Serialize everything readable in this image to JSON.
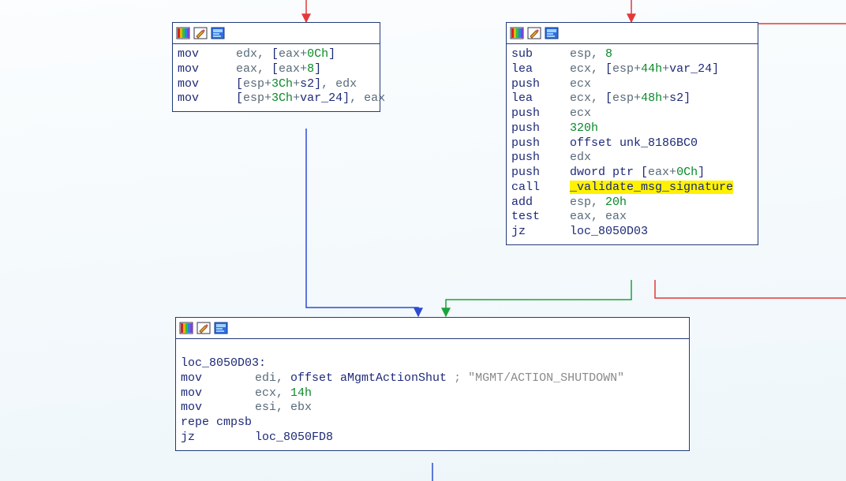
{
  "icons": {
    "rainbow": "rainbow-icon",
    "pencil": "pencil-icon",
    "script": "script-icon"
  },
  "colors": {
    "edge_red": "#e63838",
    "edge_blue": "#2e4bd3",
    "edge_green": "#1aa33a",
    "box_border": "#253a7a",
    "mnemonic": "#1e2a78",
    "register": "#596b7a",
    "number": "#0a8a2a",
    "highlight": "#fff200",
    "comment": "#8a8a8a"
  },
  "nodes": {
    "a": {
      "lines": [
        {
          "mn": "mov",
          "parts": [
            [
              "reg",
              "edx"
            ],
            [
              "punct",
              ", "
            ],
            [
              "brk",
              "["
            ],
            [
              "reg",
              "eax"
            ],
            [
              "punct",
              "+"
            ],
            [
              "num",
              "0Ch"
            ],
            [
              "brk",
              "]"
            ]
          ]
        },
        {
          "mn": "mov",
          "parts": [
            [
              "reg",
              "eax"
            ],
            [
              "punct",
              ", "
            ],
            [
              "brk",
              "["
            ],
            [
              "reg",
              "eax"
            ],
            [
              "punct",
              "+"
            ],
            [
              "num",
              "8"
            ],
            [
              "brk",
              "]"
            ]
          ]
        },
        {
          "mn": "mov",
          "parts": [
            [
              "brk",
              "["
            ],
            [
              "reg",
              "esp"
            ],
            [
              "punct",
              "+"
            ],
            [
              "num",
              "3Ch"
            ],
            [
              "punct",
              "+"
            ],
            [
              "name",
              "s2"
            ],
            [
              "brk",
              "]"
            ],
            [
              "punct",
              ", "
            ],
            [
              "reg",
              "edx"
            ]
          ]
        },
        {
          "mn": "mov",
          "parts": [
            [
              "brk",
              "["
            ],
            [
              "reg",
              "esp"
            ],
            [
              "punct",
              "+"
            ],
            [
              "num",
              "3Ch"
            ],
            [
              "punct",
              "+"
            ],
            [
              "name",
              "var_24"
            ],
            [
              "brk",
              "]"
            ],
            [
              "punct",
              ", "
            ],
            [
              "reg",
              "eax"
            ]
          ]
        }
      ]
    },
    "b": {
      "lines": [
        {
          "mn": "sub",
          "parts": [
            [
              "reg",
              "esp"
            ],
            [
              "punct",
              ", "
            ],
            [
              "num",
              "8"
            ]
          ]
        },
        {
          "mn": "lea",
          "parts": [
            [
              "reg",
              "ecx"
            ],
            [
              "punct",
              ", "
            ],
            [
              "brk",
              "["
            ],
            [
              "reg",
              "esp"
            ],
            [
              "punct",
              "+"
            ],
            [
              "num",
              "44h"
            ],
            [
              "punct",
              "+"
            ],
            [
              "name",
              "var_24"
            ],
            [
              "brk",
              "]"
            ]
          ]
        },
        {
          "mn": "push",
          "parts": [
            [
              "reg",
              "ecx"
            ]
          ]
        },
        {
          "mn": "lea",
          "parts": [
            [
              "reg",
              "ecx"
            ],
            [
              "punct",
              ", "
            ],
            [
              "brk",
              "["
            ],
            [
              "reg",
              "esp"
            ],
            [
              "punct",
              "+"
            ],
            [
              "num",
              "48h"
            ],
            [
              "punct",
              "+"
            ],
            [
              "name",
              "s2"
            ],
            [
              "brk",
              "]"
            ]
          ]
        },
        {
          "mn": "push",
          "parts": [
            [
              "reg",
              "ecx"
            ]
          ]
        },
        {
          "mn": "push",
          "parts": [
            [
              "num",
              "320h"
            ]
          ]
        },
        {
          "mn": "push",
          "parts": [
            [
              "name",
              "offset unk_8186BC0"
            ]
          ]
        },
        {
          "mn": "push",
          "parts": [
            [
              "reg",
              "edx"
            ]
          ]
        },
        {
          "mn": "push",
          "parts": [
            [
              "name",
              "dword ptr "
            ],
            [
              "brk",
              "["
            ],
            [
              "reg",
              "eax"
            ],
            [
              "punct",
              "+"
            ],
            [
              "num",
              "0Ch"
            ],
            [
              "brk",
              "]"
            ]
          ]
        },
        {
          "mn": "call",
          "parts": [
            [
              "hl",
              "_validate_msg_signature"
            ]
          ]
        },
        {
          "mn": "add",
          "parts": [
            [
              "reg",
              "esp"
            ],
            [
              "punct",
              ", "
            ],
            [
              "num",
              "20h"
            ]
          ]
        },
        {
          "mn": "test",
          "parts": [
            [
              "reg",
              "eax"
            ],
            [
              "punct",
              ", "
            ],
            [
              "reg",
              "eax"
            ]
          ]
        },
        {
          "mn": "jz",
          "parts": [
            [
              "label",
              "loc_8050D03"
            ]
          ]
        }
      ]
    },
    "c": {
      "label": "loc_8050D03:",
      "lines": [
        {
          "mn": "mov",
          "wide": true,
          "parts": [
            [
              "reg",
              "edi"
            ],
            [
              "punct",
              ", "
            ],
            [
              "name",
              "offset aMgmtActionShut"
            ],
            [
              "punct",
              " "
            ],
            [
              "comment",
              "; \"MGMT/ACTION_SHUTDOWN\""
            ]
          ]
        },
        {
          "mn": "mov",
          "wide": true,
          "parts": [
            [
              "reg",
              "ecx"
            ],
            [
              "punct",
              ", "
            ],
            [
              "num",
              "14h"
            ]
          ]
        },
        {
          "mn": "mov",
          "wide": true,
          "parts": [
            [
              "reg",
              "esi"
            ],
            [
              "punct",
              ", "
            ],
            [
              "reg",
              "ebx"
            ]
          ]
        },
        {
          "mn": "repe cmpsb",
          "wide": true,
          "raw": true,
          "parts": []
        },
        {
          "mn": "jz",
          "wide": true,
          "parts": [
            [
              "label",
              "loc_8050FD8"
            ]
          ]
        }
      ]
    }
  }
}
